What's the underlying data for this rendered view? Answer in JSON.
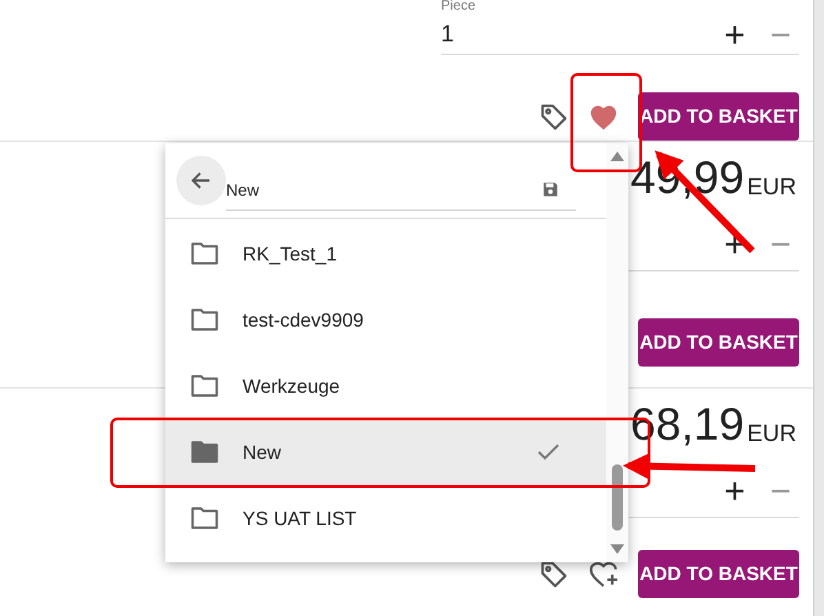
{
  "product_rows": [
    {
      "quantity": {
        "label": "Piece",
        "value": "1",
        "increase": "+",
        "decrease": "−"
      },
      "favorite": true,
      "button": "ADD TO BASKET"
    },
    {
      "price": "49,99",
      "currency": "EUR",
      "quantity": {
        "increase": "+",
        "decrease": "−"
      },
      "button": "ADD TO BASKET"
    },
    {
      "price": "68,19",
      "currency": "EUR",
      "quantity": {
        "increase": "+",
        "decrease": "−"
      },
      "favorite": false,
      "button": "ADD TO BASKET"
    }
  ],
  "wishlist_popup": {
    "list_name": "New",
    "items": [
      {
        "name": "RK_Test_1",
        "selected": false
      },
      {
        "name": "test-cdev9909",
        "selected": false
      },
      {
        "name": "Werkzeuge",
        "selected": false
      },
      {
        "name": "New",
        "selected": true
      },
      {
        "name": "YS UAT LIST",
        "selected": false
      }
    ]
  }
}
